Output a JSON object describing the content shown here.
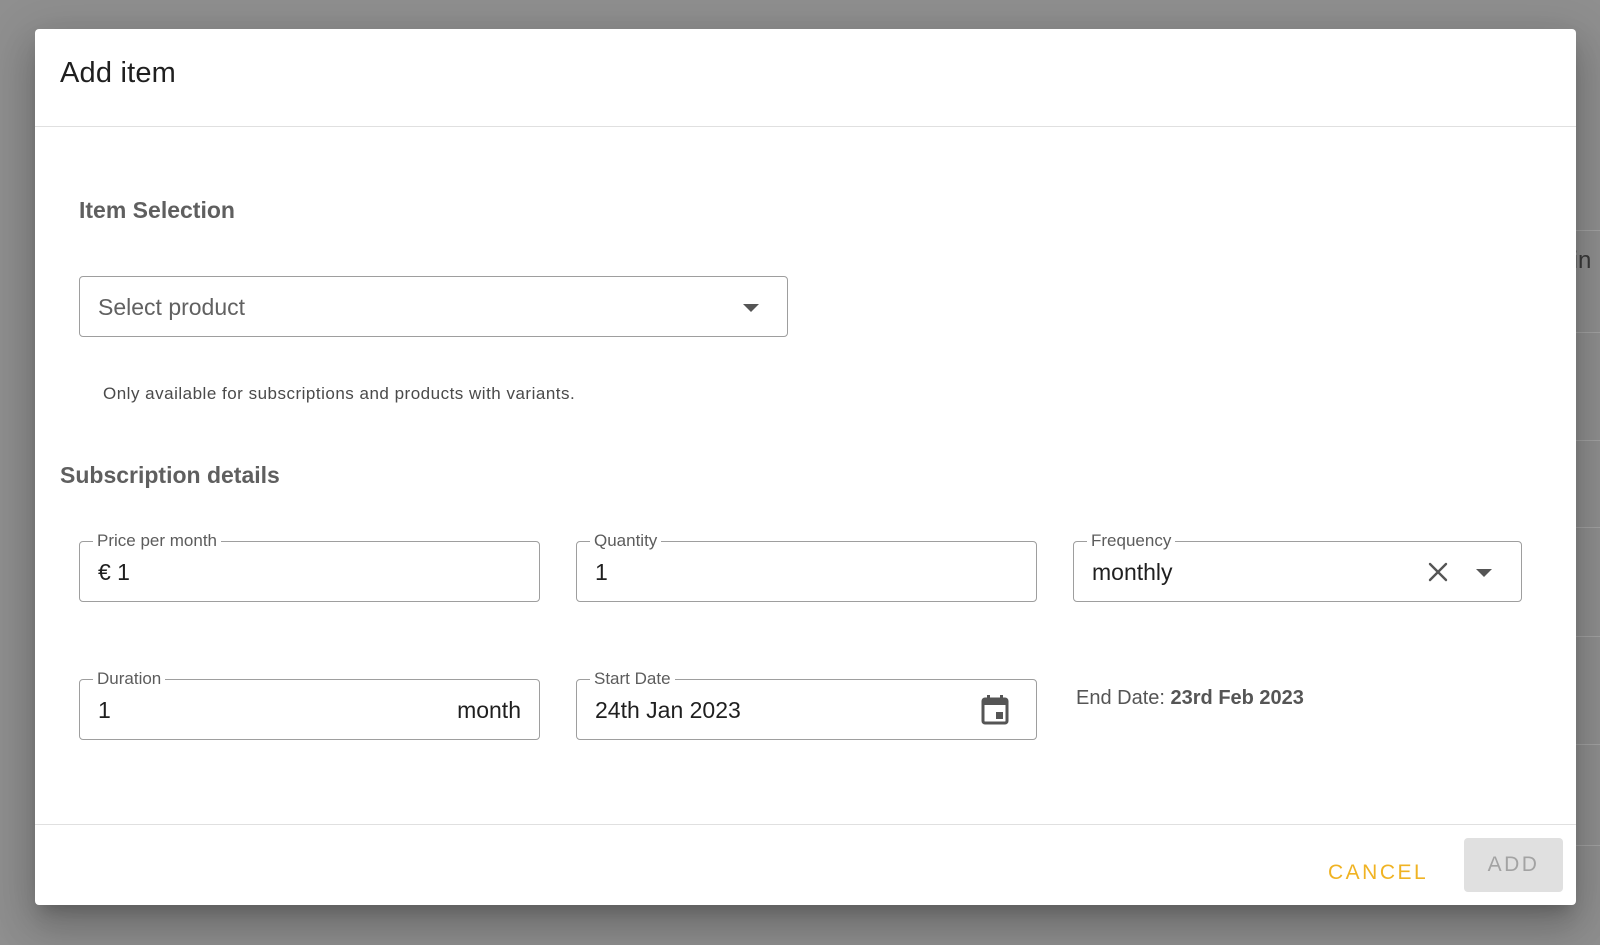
{
  "dialog": {
    "title": "Add item",
    "item_selection": {
      "heading": "Item Selection",
      "product_select_placeholder": "Select product",
      "hint": "Only available for subscriptions and products with variants."
    },
    "subscription": {
      "heading": "Subscription details",
      "price": {
        "label": "Price per month",
        "value": "€ 1"
      },
      "quantity": {
        "label": "Quantity",
        "value": "1"
      },
      "frequency": {
        "label": "Frequency",
        "value": "monthly"
      },
      "duration": {
        "label": "Duration",
        "value": "1",
        "unit": "month"
      },
      "start_date": {
        "label": "Start Date",
        "value": "24th Jan 2023"
      },
      "end_date": {
        "label": "End Date:",
        "value": "23rd Feb 2023"
      }
    },
    "actions": {
      "cancel": "CANCEL",
      "add": "ADD"
    }
  },
  "background": {
    "partial_text": "tin"
  },
  "colors": {
    "accent": "#f0b323",
    "disabled_bg": "#e0e0e0",
    "overlay": "#8f8f8f"
  }
}
